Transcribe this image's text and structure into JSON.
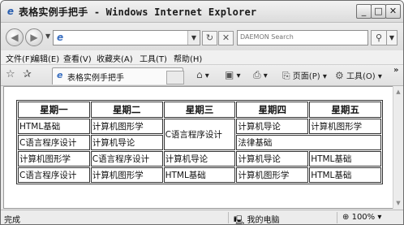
{
  "window": {
    "title": "表格实例手把手 - Windows Internet Explorer",
    "min_glyph": "_",
    "max_glyph": "□",
    "close_glyph": "✕"
  },
  "address_bar": {
    "value": "",
    "search_placeholder": "DAEMON Search"
  },
  "menu": [
    "文件(F)",
    "编辑(E)",
    "查看(V)",
    "收藏夹(A)",
    "工具(T)",
    "帮助(H)"
  ],
  "tab": {
    "label": "表格实例手把手"
  },
  "commands": {
    "page": "页面(P)",
    "tools": "工具(O)"
  },
  "table": {
    "headers": [
      "星期一",
      "星期二",
      "星期三",
      "星期四",
      "星期五"
    ],
    "rows": [
      [
        "HTML基础",
        "计算机图形学",
        "C语言程序设计",
        "计算机导论",
        "计算机图形学"
      ],
      [
        "C语言程序设计",
        "计算机导论",
        "法律基础"
      ],
      [
        "计算机图形学",
        "C语言程序设计",
        "计算机导论",
        "计算机导论",
        "HTML基础"
      ],
      [
        "C语言程序设计",
        "计算机图形学",
        "HTML基础",
        "计算机图形学",
        "HTML基础"
      ]
    ]
  },
  "status": {
    "text": "完成",
    "zone": "我的电脑",
    "zoom": "100%"
  }
}
